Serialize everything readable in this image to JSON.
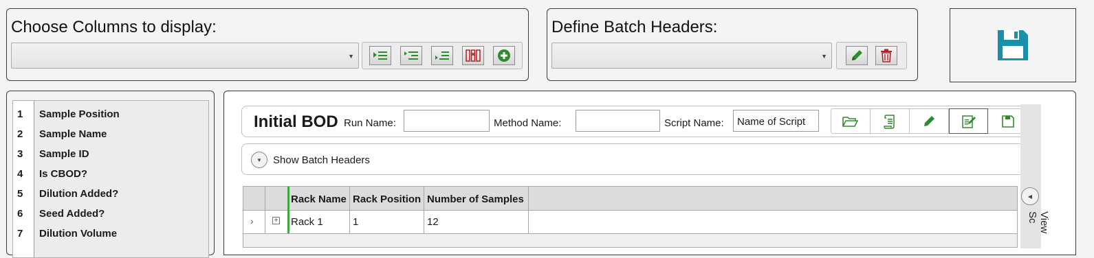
{
  "columns_panel": {
    "title": "Choose Columns to display:",
    "combo_value": "",
    "buttons": [
      "indent-right-icon",
      "list-indent-icon",
      "list-outdent-icon",
      "remove-columns-icon",
      "add-circle-icon"
    ]
  },
  "batch_panel": {
    "title": "Define Batch Headers:",
    "combo_value": "",
    "buttons": [
      "pencil-icon",
      "trash-icon"
    ]
  },
  "save_button": {
    "icon": "floppy-disk-icon",
    "color": "#1a8fa8"
  },
  "columns_list": [
    {
      "num": "1",
      "label": "Sample Position"
    },
    {
      "num": "2",
      "label": "Sample Name"
    },
    {
      "num": "3",
      "label": "Sample ID"
    },
    {
      "num": "4",
      "label": "Is CBOD?"
    },
    {
      "num": "5",
      "label": "Dilution Added?"
    },
    {
      "num": "6",
      "label": "Seed Added?"
    },
    {
      "num": "7",
      "label": "Dilution Volume"
    }
  ],
  "header": {
    "title": "Initial BOD",
    "run_name_label": "Run Name:",
    "run_name_value": "",
    "method_name_label": "Method Name:",
    "method_name_value": "",
    "script_name_label": "Script Name:",
    "script_name_value": "Name of Script",
    "buttons": [
      "folder-open-icon",
      "script-icon",
      "pencil-icon",
      "edit-note-icon",
      "save-icon"
    ]
  },
  "batch_toggle": {
    "label": "Show Batch Headers"
  },
  "grid": {
    "columns": [
      "Rack Name",
      "Rack Position",
      "Number of Samples"
    ],
    "rows": [
      {
        "rack_name": "Rack 1",
        "rack_position": "1",
        "number_of_samples": "12"
      }
    ]
  },
  "side_panel": {
    "label": "View Sc"
  },
  "colors": {
    "accent_green": "#2e8b2e",
    "danger_red": "#b22222",
    "save_teal": "#1a8fa8"
  }
}
